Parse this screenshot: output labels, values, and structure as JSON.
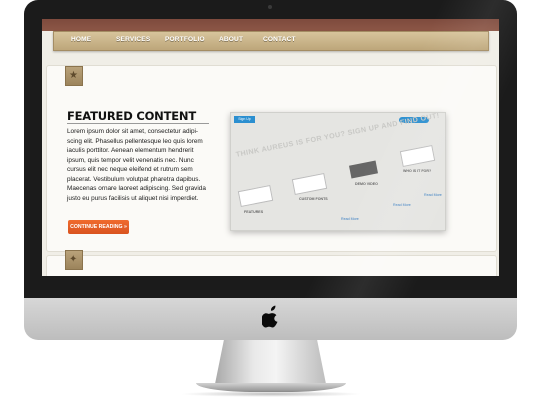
{
  "site": {
    "nav": {
      "items": [
        {
          "label": "HOME"
        },
        {
          "label": "SERVICES"
        },
        {
          "label": "PORTFOLIO"
        },
        {
          "label": "ABOUT"
        },
        {
          "label": "CONTACT"
        }
      ]
    },
    "featured": {
      "title": "FEATURED CONTENT",
      "body": "Lorem ipsum dolor sit amet, consectetur adipi-\nscing elit. Phasellus pellentesque leo quis lorem\niaculis porttitor. Aenean elementum hendrerit\nipsum, quis tempor velit venenatis nec. Nunc\ncursus elit nec neque eleifend et rutrum sem\nplacerat. Vestibulum volutpat pharetra dapibus.\nMaecenas ornare laoreet adipiscing. Sed gravida\njusto eu purus facilisis ut aliquet nisi imperdiet.",
      "cta_label": "CONTINUE READING »"
    },
    "preview": {
      "signup_label": "Sign Up",
      "headline": "THINK AUREUS IS FOR YOU? SIGN UP AND FIND OUT!",
      "thumb_labels": [
        "FEATURES",
        "CUSTOM FONTS",
        "DEMO VIDEO",
        "WHO IS IT FOR?"
      ],
      "link_labels": [
        "Read More",
        "Read More",
        "Read More"
      ]
    }
  },
  "colors": {
    "accent_orange": "#e05a22",
    "nav_tan": "#c8b388",
    "topbar_brown": "#82503f",
    "bezel": "#1b1b1b"
  },
  "icons": {
    "featured_ribbon": "star-icon",
    "lower_ribbon": "lightbulb-icon",
    "device_logo": "apple-logo-icon"
  }
}
